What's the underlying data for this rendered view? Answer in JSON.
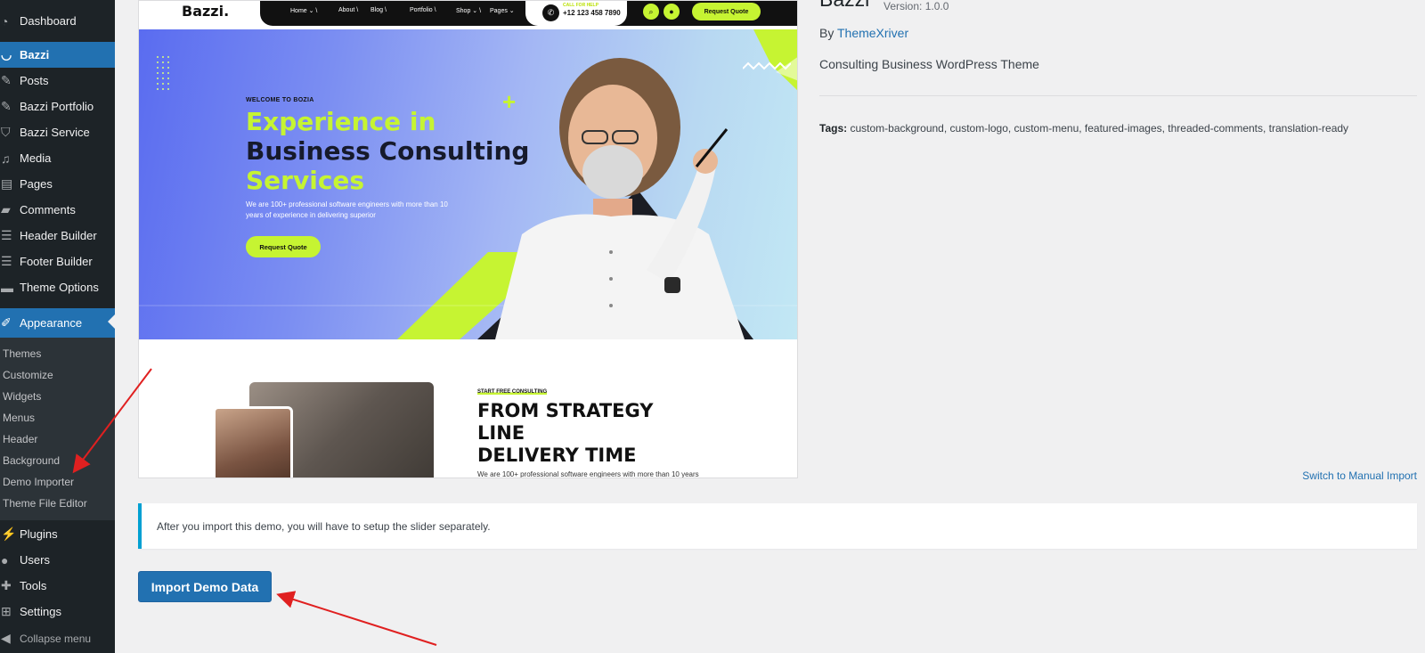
{
  "colors": {
    "sidebar_bg": "#1d2327",
    "accent": "#2271b1",
    "lime": "#c6f432",
    "arrow": "#e02020"
  },
  "sidebar": {
    "items": [
      {
        "label": "Dashboard",
        "icon": "dashboard-icon"
      },
      {
        "label": "Bazzi",
        "icon": "bazzi-icon"
      },
      {
        "label": "Posts",
        "icon": "pin-icon"
      },
      {
        "label": "Bazzi Portfolio",
        "icon": "pin-icon"
      },
      {
        "label": "Bazzi Service",
        "icon": "shield-icon"
      },
      {
        "label": "Media",
        "icon": "media-icon"
      },
      {
        "label": "Pages",
        "icon": "pages-icon"
      },
      {
        "label": "Comments",
        "icon": "comment-icon"
      },
      {
        "label": "Header Builder",
        "icon": "builder-icon"
      },
      {
        "label": "Footer Builder",
        "icon": "builder-icon"
      },
      {
        "label": "Theme Options",
        "icon": "folder-icon"
      },
      {
        "label": "Appearance",
        "icon": "brush-icon"
      }
    ],
    "submenu": [
      "Themes",
      "Customize",
      "Widgets",
      "Menus",
      "Header",
      "Background",
      "Demo Importer",
      "Theme File Editor"
    ],
    "bottom_items": [
      {
        "label": "Plugins",
        "icon": "plugin-icon"
      },
      {
        "label": "Users",
        "icon": "user-icon"
      },
      {
        "label": "Tools",
        "icon": "wrench-icon"
      },
      {
        "label": "Settings",
        "icon": "settings-icon"
      }
    ],
    "collapse": "Collapse menu"
  },
  "preview": {
    "logo": "Bazzi.",
    "nav": [
      "Home ⌄ \\",
      "About \\",
      "Blog \\",
      "Portfolio \\",
      "Shop ⌄ \\",
      "Pages ⌄"
    ],
    "call_label": "CALL FOR HELP",
    "phone": "+12 123 458 7890",
    "nav_button": "Request Quote",
    "hero_welcome": "WELCOME TO BOZIA",
    "hero_line1": "Experience in",
    "hero_line2": "Business Consulting",
    "hero_line3": "Services",
    "hero_text": "We are 100+ professional software engineers with more than 10 years of experience in delivering superior",
    "hero_button": "Request Quote",
    "s2_small": "START FREE CONSULTING",
    "s2_line1": "FROM STRATEGY",
    "s2_line2": "LINE",
    "s2_line3": "DELIVERY TIME",
    "s2_text": "We are 100+ professional software engineers with more than 10 years"
  },
  "theme": {
    "name": "Bazzi",
    "version": "Version: 1.0.0",
    "by_prefix": "By",
    "author": "ThemeXriver",
    "description": "Consulting Business WordPress Theme",
    "tags_label": "Tags:",
    "tags": "custom-background, custom-logo, custom-menu, featured-images, threaded-comments, translation-ready",
    "switch_link": "Switch to Manual Import"
  },
  "notice": "After you import this demo, you will have to setup the slider separately.",
  "import_button": "Import Demo Data"
}
